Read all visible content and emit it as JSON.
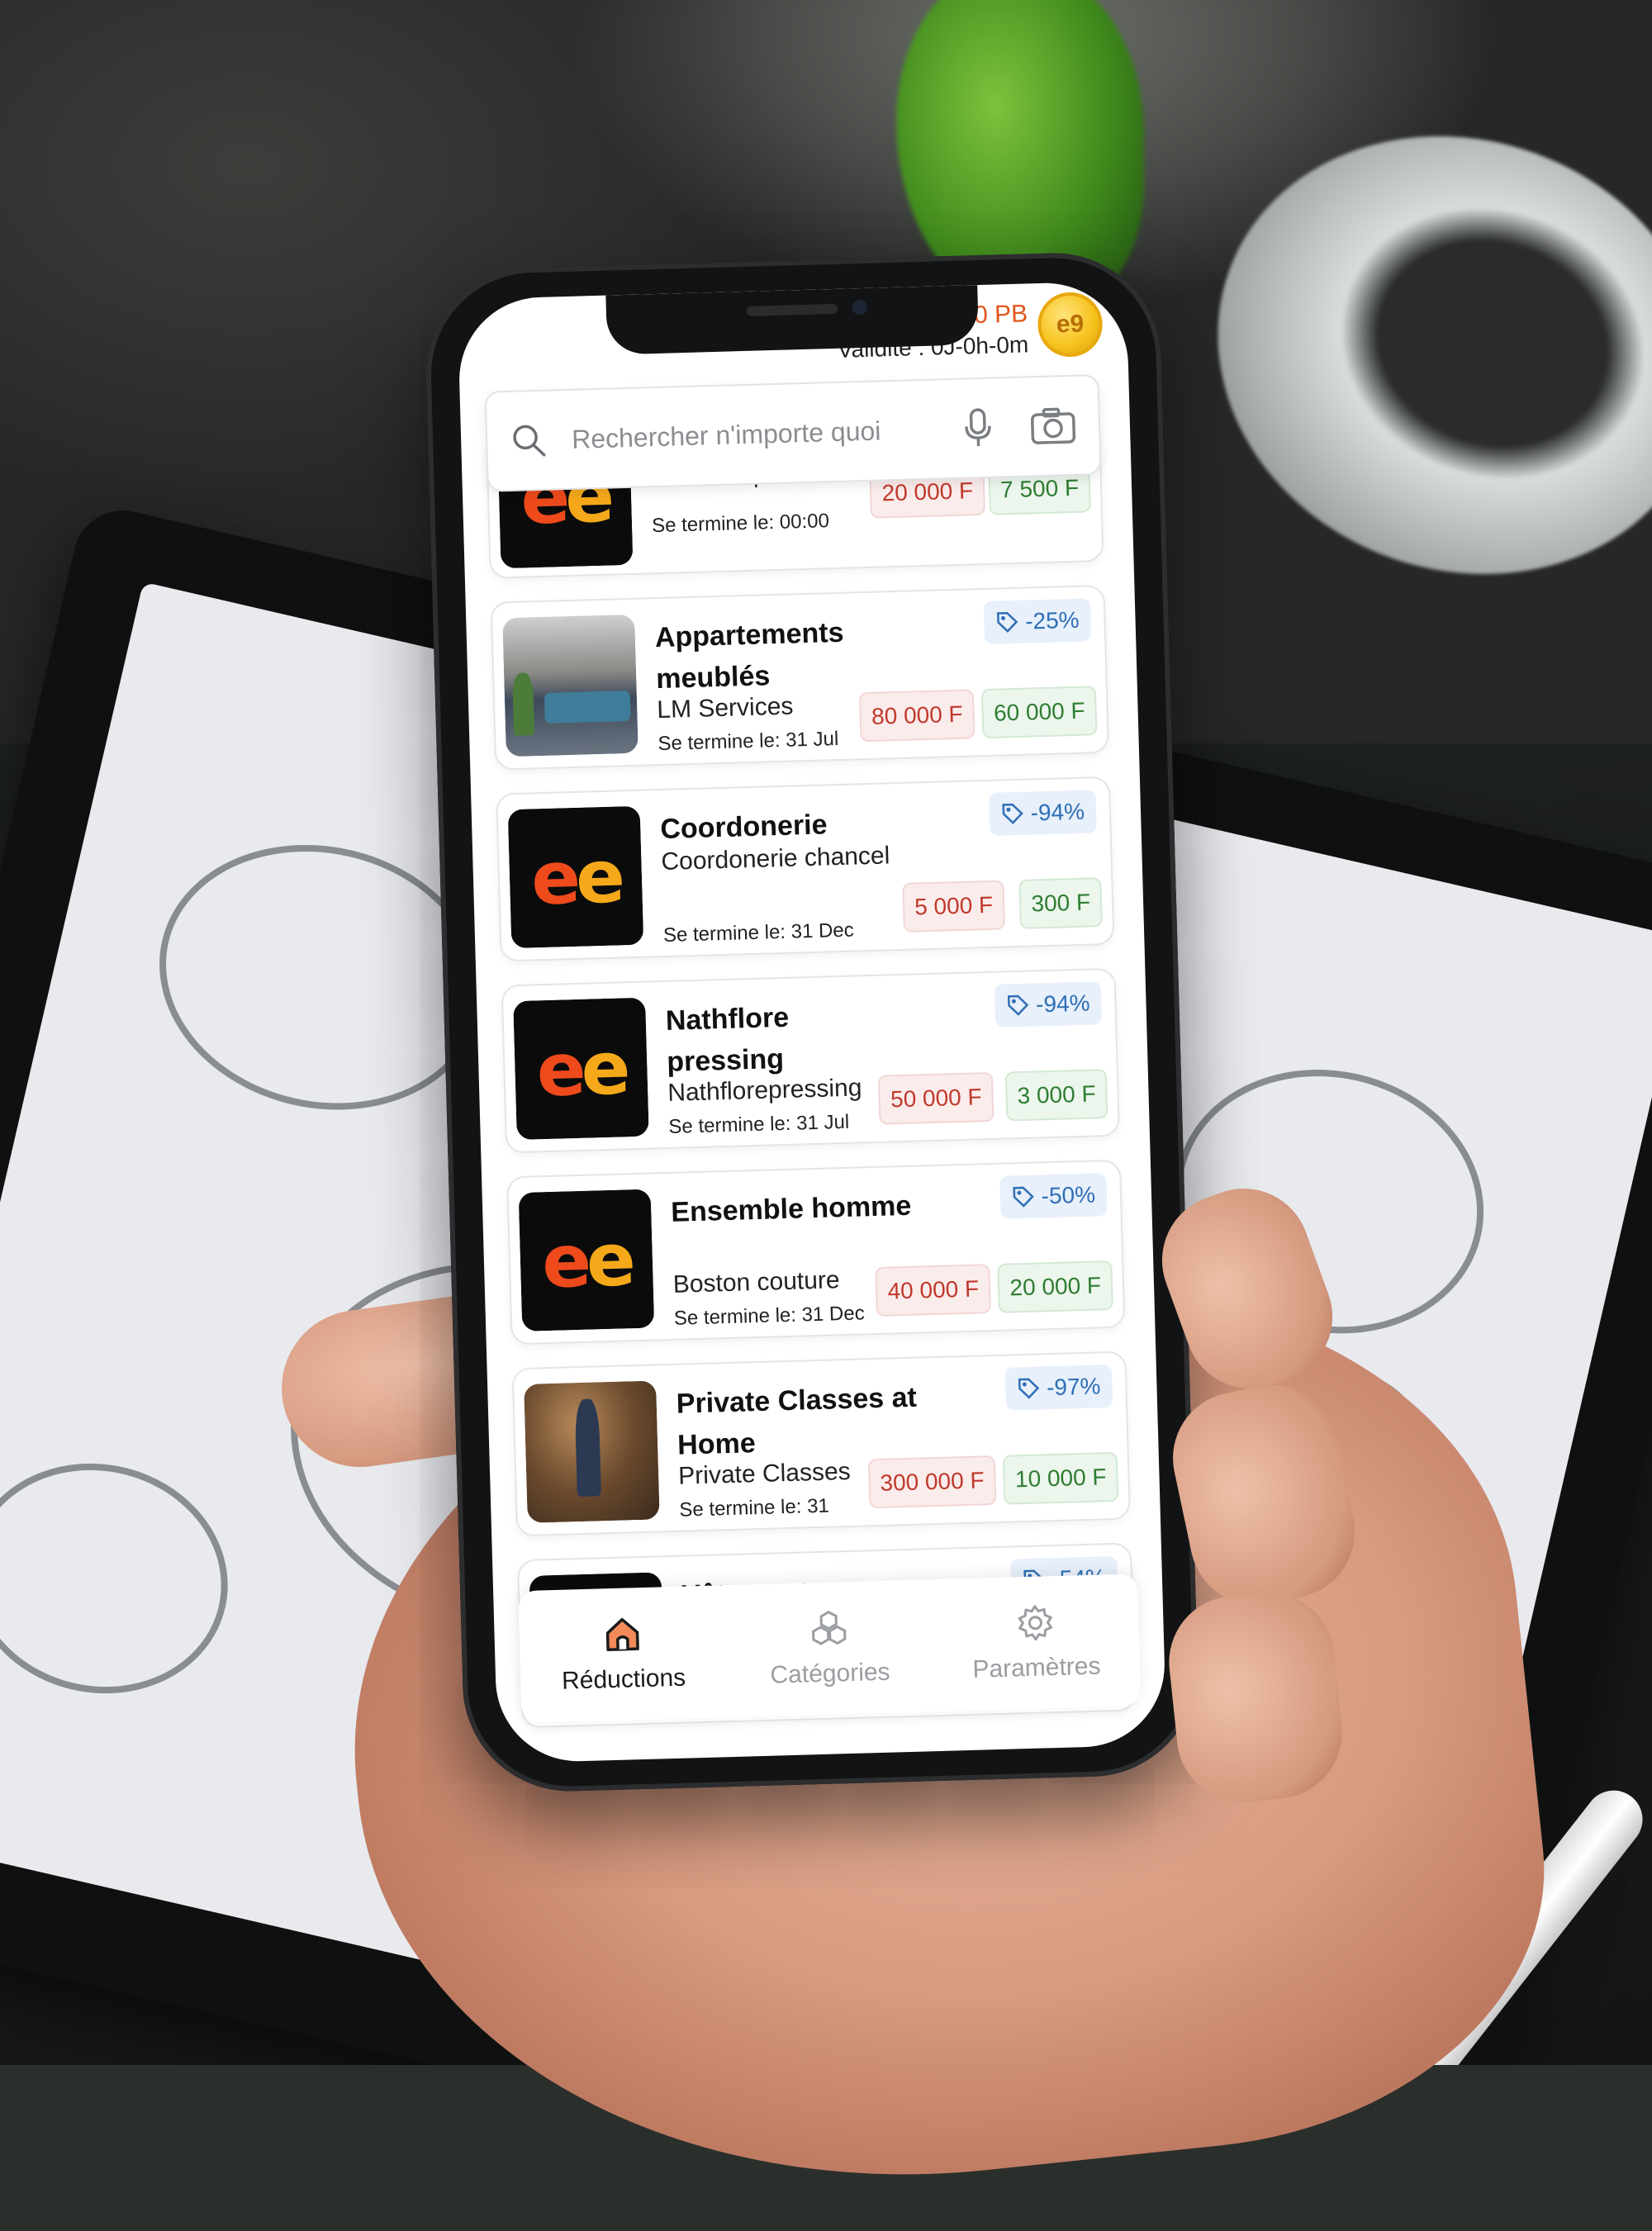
{
  "status": {
    "balance": "0 PB",
    "validity": "Validité : 0J-0h-0m",
    "coin_logo": "e9"
  },
  "search": {
    "placeholder": "Rechercher n'importe quoi",
    "icons": [
      "search-icon",
      "microphone-icon",
      "camera-icon"
    ]
  },
  "offers": [
    {
      "title": "",
      "shop": "kevin'shop",
      "ends": "Se termine le: 00:00",
      "discount": "",
      "old_price": "20 000 F",
      "new_price": "7 500 F",
      "thumb": "logo"
    },
    {
      "title": "Appartements meublés",
      "shop": "LM Services",
      "ends": "Se termine le: 31 Jul",
      "discount": "-25%",
      "old_price": "80 000 F",
      "new_price": "60 000 F",
      "thumb": "room"
    },
    {
      "title": "Coordonerie",
      "shop": "Coordonerie chancel",
      "ends": "Se termine le: 31 Dec",
      "discount": "-94%",
      "old_price": "5 000 F",
      "new_price": "300 F",
      "thumb": "logo"
    },
    {
      "title": "Nathflore pressing",
      "shop": "Nathflorepressing",
      "ends": "Se termine le: 31 Jul",
      "discount": "-94%",
      "old_price": "50 000 F",
      "new_price": "3 000 F",
      "thumb": "logo"
    },
    {
      "title": "Ensemble homme",
      "shop": "Boston couture",
      "ends": "Se termine le: 31 Dec",
      "discount": "-50%",
      "old_price": "40 000 F",
      "new_price": "20 000 F",
      "thumb": "logo"
    },
    {
      "title": "Private Classes at Home",
      "shop": "Private Classes",
      "ends": "Se termine le: 31",
      "discount": "-97%",
      "old_price": "300 000 F",
      "new_price": "10 000 F",
      "thumb": "class"
    },
    {
      "title": "Vêtements",
      "shop": "",
      "ends": "",
      "discount": "-54%",
      "old_price": "",
      "new_price": "",
      "thumb": "logo"
    }
  ],
  "tabs": [
    {
      "label": "Réductions",
      "icon": "home-icon",
      "active": true
    },
    {
      "label": "Catégories",
      "icon": "categories-icon",
      "active": false
    },
    {
      "label": "Paramètres",
      "icon": "gear-icon",
      "active": false
    }
  ],
  "colors": {
    "accent": "#e2561b",
    "old_price": "#c0392b",
    "new_price": "#2e7d32",
    "badge": "#2f6fb5"
  }
}
